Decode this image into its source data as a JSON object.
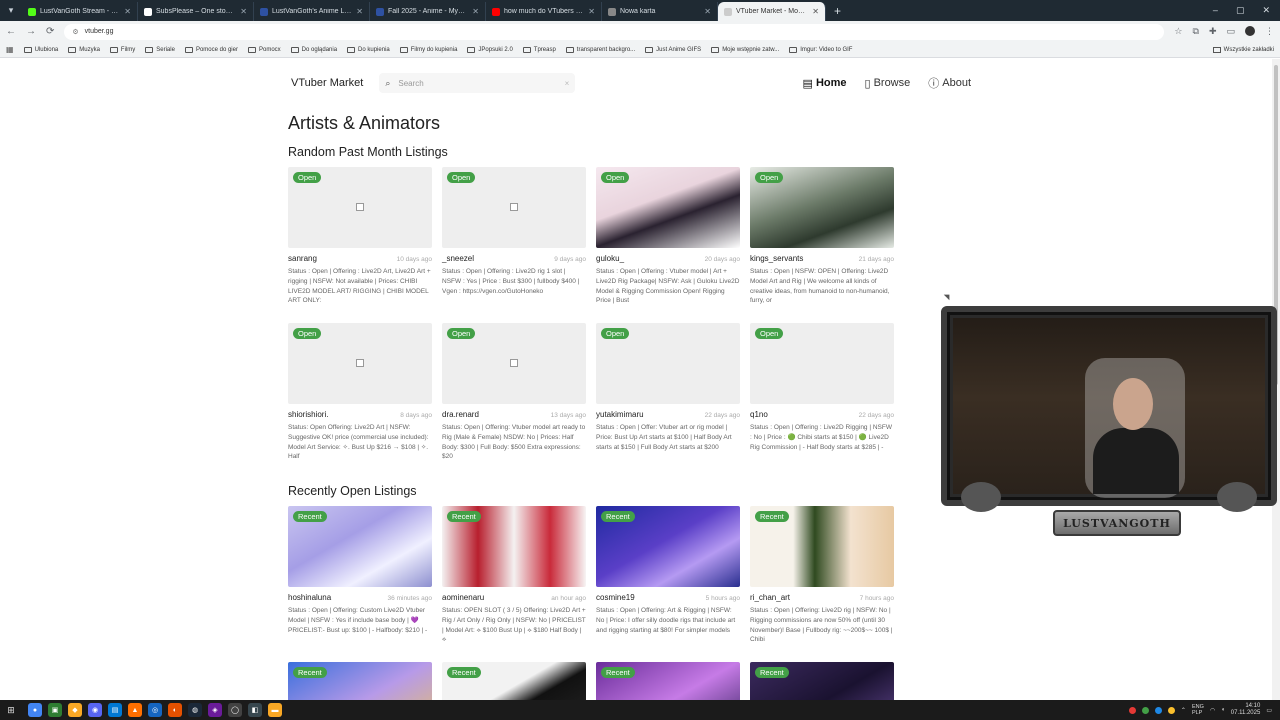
{
  "browser": {
    "tabs": [
      {
        "title": "LustVanGoth Stream - Watch L...",
        "color": "#53fc18",
        "active": false
      },
      {
        "title": "SubsPlease – One stop shop fo...",
        "color": "#ffffff",
        "active": false
      },
      {
        "title": "LustVanGoth's Anime List - My...",
        "color": "#2e51a2",
        "active": false
      },
      {
        "title": "Fall 2025 - Anime - MyAnimeLi...",
        "color": "#2e51a2",
        "active": false
      },
      {
        "title": "how much do VTubers make?",
        "color": "#ff0000",
        "active": false
      },
      {
        "title": "Nowa karta",
        "color": "#888888",
        "active": false
      },
      {
        "title": "VTuber Market - Models & Au...",
        "color": "#cccccc",
        "active": true
      }
    ],
    "url": "vtuber.gg",
    "bookmarks": [
      "Ulubiona",
      "Muzyka",
      "Filmy",
      "Seriale",
      "Pomoce do gier",
      "Pomocx",
      "Do oglądania",
      "Do kupienia",
      "Filmy do kupienia",
      "JPopsuki 2.0",
      "Tpreasp",
      "transparent backgro...",
      "Just Anime GIFS",
      "Moje wstępnie zatw...",
      "Imgur: Video to GIF"
    ],
    "bookmarks_right": "Wszystkie zakładki"
  },
  "site": {
    "brand": "VTuber Market",
    "search_placeholder": "Search",
    "search_clear": "×",
    "nav": [
      {
        "label": "Home",
        "icon": "home-icon",
        "active": true
      },
      {
        "label": "Browse",
        "icon": "book-icon",
        "active": false
      },
      {
        "label": "About",
        "icon": "info-icon",
        "active": false
      }
    ]
  },
  "page": {
    "title": "Artists & Animators",
    "section1_title": "Random Past Month Listings",
    "section2_title": "Recently Open Listings"
  },
  "random_listings": [
    {
      "badge": "Open",
      "name": "sanrang",
      "time": "10 days ago",
      "desc": "Status : Open | Offering : Live2D Art, Live2D Art + rigging | NSFW: Not available | Prices: CHIBI LIVE2D MODEL ART/ RIGGING | CHIBI MODEL ART ONLY:",
      "image": "broken"
    },
    {
      "badge": "Open",
      "name": "_sneezel",
      "time": "9 days ago",
      "desc": "Status : Open | Offering : Live2D rig 1 slot | NSFW : Yes | Price : Bust $300 | fullbody $400 | Vgen : https://vgen.co/GutoHoneko",
      "image": "broken"
    },
    {
      "badge": "Open",
      "name": "guloku_",
      "time": "20 days ago",
      "desc": "Status : Open | Offering : Vtuber model | Art + Live2D Rig Package| NSFW: Ask | Guloku Live2D Model & Rigging Commission Open! Rigging Price | Bust",
      "image": "art-a"
    },
    {
      "badge": "Open",
      "name": "kings_servants",
      "time": "21 days ago",
      "desc": "Status : Open | NSFW: OPEN | Offering: Live2D Model Art and Rig | We welcome all kinds of creative ideas, from humanoid to non-humanoid, furry, or",
      "image": "art-b"
    },
    {
      "badge": "Open",
      "name": "shiorishiori.",
      "time": "8 days ago",
      "desc": "Status: Open Offering: Live2D Art | NSFW: Suggestive OK! price (commercial use included): Model Art Service: ✧. Bust Up $216 → $108 | ✧. Half",
      "image": "broken"
    },
    {
      "badge": "Open",
      "name": "dra.renard",
      "time": "13 days ago",
      "desc": "Status: Open | Offering: Vtuber model art ready to Rig (Male & Female) NSDW: No | Prices: Half Body: $300 | Full Body: $500 Extra expressions: $20",
      "image": "broken"
    },
    {
      "badge": "Open",
      "name": "yutakimimaru",
      "time": "22 days ago",
      "desc": "Status : Open | Offer: Vtuber art or rig model | Price: Bust Up Art starts at $100 | Half Body Art starts at $150 | Full Body Art starts at $200",
      "image": "blank"
    },
    {
      "badge": "Open",
      "name": "q1no",
      "time": "22 days ago",
      "desc": "Status : Open | Offering : Live2D Rigging | NSFW : No | Price : 🟢 Chibi starts at $150 | 🟢 Live2D Rig Commission | - Half Body starts at $285 | -",
      "image": "blank"
    }
  ],
  "recent_listings": [
    {
      "badge": "Recent",
      "name": "hoshinaluna",
      "time": "36 minutes ago",
      "desc": "Status : Open | Offering: Custom Live2D Vtuber Model | NSFW : Yes if include base body | 💜 PRICELIST:- Bust up: $100 | - Halfbody: $210 | -",
      "image": "art-c"
    },
    {
      "badge": "Recent",
      "name": "aominenaru",
      "time": "an hour ago",
      "desc": "Status: OPEN SLOT ( 3 / 5) Offering: Live2D Art + Rig / Art Only / Rig Only | NSFW: No | PRICELIST | Model Art: ⟡ $100 Bust Up | ⟡ $180 Half Body | ⟡",
      "image": "art-d"
    },
    {
      "badge": "Recent",
      "name": "cosmine19",
      "time": "5 hours ago",
      "desc": "Status : Open | Offering: Art & Rigging | NSFW: No | Price: I offer silly doodle rigs that include art and rigging starting at $80! For simpler models",
      "image": "art-e"
    },
    {
      "badge": "Recent",
      "name": "ri_chan_art",
      "time": "7 hours ago",
      "desc": "Status : Open | Offering: Live2D rig | NSFW: No | Rigging commissions are now 50% off (until 30 November)! Base | Fullbody rig: ~~200$~~ 100$ | Chibi",
      "image": "art-f"
    },
    {
      "badge": "Recent",
      "name": "",
      "time": "",
      "desc": "",
      "image": "art-g"
    },
    {
      "badge": "Recent",
      "name": "",
      "time": "",
      "desc": "",
      "image": "art-h"
    },
    {
      "badge": "Recent",
      "name": "",
      "time": "",
      "desc": "",
      "image": "art-i"
    },
    {
      "badge": "Recent",
      "name": "",
      "time": "",
      "desc": "",
      "image": "art-j"
    }
  ],
  "overlay": {
    "plaque": "LUSTVANGOTH"
  },
  "taskbar": {
    "lang": "ENG",
    "lang2": "PLP",
    "time": "14:10",
    "date": "07.11.2025"
  }
}
